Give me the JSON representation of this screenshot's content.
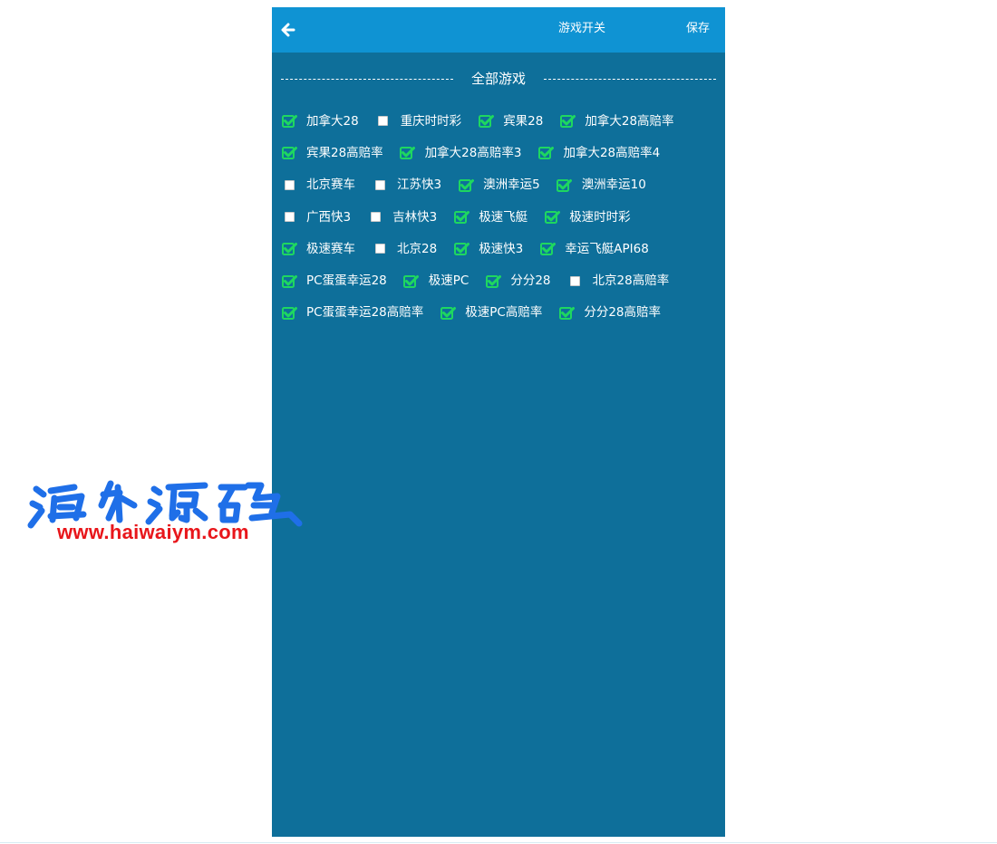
{
  "header": {
    "title": "游戏开关",
    "save_label": "保存",
    "back_icon": "arrow-left-icon"
  },
  "section": {
    "title": "全部游戏"
  },
  "colors": {
    "panel_bg": "#0e6f9a",
    "header_bg": "#0f93d3",
    "check_green": "#1ed760",
    "watermark_blue": "#1f6fe8",
    "watermark_red": "#e8161b"
  },
  "games": [
    [
      {
        "label": "加拿大28",
        "checked": true
      },
      {
        "label": "重庆时时彩",
        "checked": false
      },
      {
        "label": "宾果28",
        "checked": true
      },
      {
        "label": "加拿大28高赔率",
        "checked": true
      }
    ],
    [
      {
        "label": "宾果28高赔率",
        "checked": true
      },
      {
        "label": "加拿大28高赔率3",
        "checked": true
      },
      {
        "label": "加拿大28高赔率4",
        "checked": true
      }
    ],
    [
      {
        "label": "北京赛车",
        "checked": false
      },
      {
        "label": "江苏快3",
        "checked": false
      },
      {
        "label": "澳洲幸运5",
        "checked": true
      },
      {
        "label": "澳洲幸运10",
        "checked": true
      }
    ],
    [
      {
        "label": "广西快3",
        "checked": false
      },
      {
        "label": "吉林快3",
        "checked": false
      },
      {
        "label": "极速飞艇",
        "checked": true
      },
      {
        "label": "极速时时彩",
        "checked": true
      }
    ],
    [
      {
        "label": "极速赛车",
        "checked": true
      },
      {
        "label": "北京28",
        "checked": false
      },
      {
        "label": "极速快3",
        "checked": true
      },
      {
        "label": "幸运飞艇API68",
        "checked": true
      }
    ],
    [
      {
        "label": "PC蛋蛋幸运28",
        "checked": true
      },
      {
        "label": "极速PC",
        "checked": true
      },
      {
        "label": "分分28",
        "checked": true
      },
      {
        "label": "北京28高赔率",
        "checked": false
      }
    ],
    [
      {
        "label": "PC蛋蛋幸运28高赔率",
        "checked": true
      },
      {
        "label": "极速PC高赔率",
        "checked": true
      },
      {
        "label": "分分28高赔率",
        "checked": true
      }
    ]
  ],
  "watermark": {
    "logo_text": "海外源码",
    "url": "www.haiwaiym.com"
  }
}
